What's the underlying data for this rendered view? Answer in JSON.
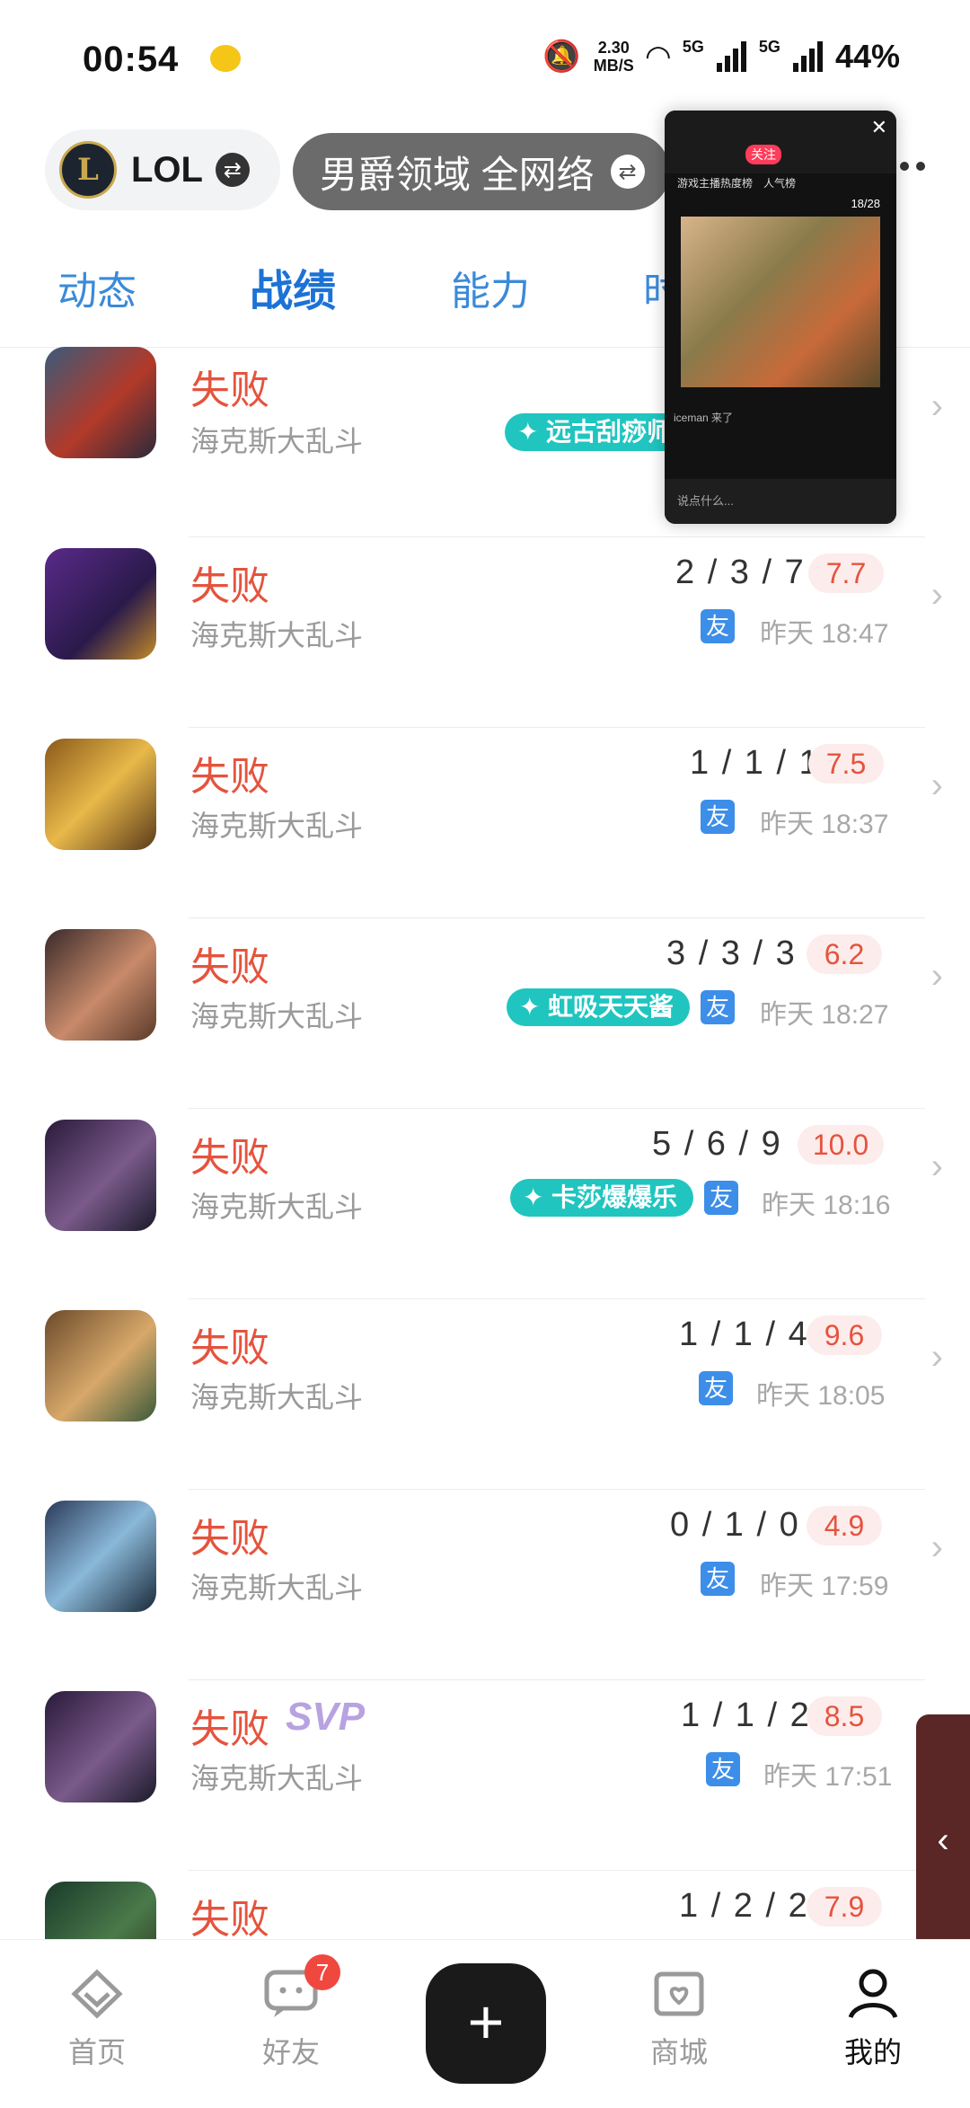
{
  "status": {
    "time": "00:54",
    "speed_value": "2.30",
    "speed_unit": "MB/S",
    "battery": "44%",
    "net1": "5G",
    "net2": "5G"
  },
  "header": {
    "game_name": "LOL",
    "game_logo": "L",
    "server_name": "男爵领域 全网络"
  },
  "tabs": [
    "动态",
    "战绩",
    "能力",
    "时"
  ],
  "matches": [
    {
      "result": "失败",
      "mode": "海克斯大乱斗",
      "tag": "远古刮痧师",
      "kda": "",
      "score": "",
      "time": "",
      "friend": false,
      "svp": ""
    },
    {
      "result": "失败",
      "mode": "海克斯大乱斗",
      "tag": "",
      "kda": "2 / 3 / 7",
      "score": "7.7",
      "time": "昨天 18:47",
      "friend": true,
      "svp": ""
    },
    {
      "result": "失败",
      "mode": "海克斯大乱斗",
      "tag": "",
      "kda": "1 / 1 / 1",
      "score": "7.5",
      "time": "昨天 18:37",
      "friend": true,
      "svp": ""
    },
    {
      "result": "失败",
      "mode": "海克斯大乱斗",
      "tag": "虹吸天天酱",
      "kda": "3 / 3 / 3",
      "score": "6.2",
      "time": "昨天 18:27",
      "friend": true,
      "svp": ""
    },
    {
      "result": "失败",
      "mode": "海克斯大乱斗",
      "tag": "卡莎爆爆乐",
      "kda": "5 / 6 / 9",
      "score": "10.0",
      "time": "昨天 18:16",
      "friend": true,
      "svp": ""
    },
    {
      "result": "失败",
      "mode": "海克斯大乱斗",
      "tag": "",
      "kda": "1 / 1 / 4",
      "score": "9.6",
      "time": "昨天 18:05",
      "friend": true,
      "svp": ""
    },
    {
      "result": "失败",
      "mode": "海克斯大乱斗",
      "tag": "",
      "kda": "0 / 1 / 0",
      "score": "4.9",
      "time": "昨天 17:59",
      "friend": true,
      "svp": ""
    },
    {
      "result": "失败",
      "mode": "海克斯大乱斗",
      "tag": "",
      "kda": "1 / 1 / 2",
      "score": "8.5",
      "time": "昨天 17:51",
      "friend": true,
      "svp": "SVP"
    },
    {
      "result": "失败",
      "mode": "",
      "tag": "",
      "kda": "1 / 2 / 2",
      "score": "7.9",
      "time": "",
      "friend": false,
      "svp": ""
    }
  ],
  "friend_label": "友",
  "video_overlay": {
    "follow_label": "关注",
    "tab1": "游戏主播热度榜",
    "tab2": "人气榜",
    "rank": "18/28",
    "chat": [
      "iceman 来了"
    ],
    "input_placeholder": "说点什么..."
  },
  "nav": {
    "home": "首页",
    "friends": "好友",
    "friends_badge": "7",
    "add": "+",
    "shop": "商城",
    "me": "我的"
  },
  "colors": {
    "accent": "#1c72d6",
    "loss": "#e5533d",
    "tag": "#20c5c0"
  }
}
